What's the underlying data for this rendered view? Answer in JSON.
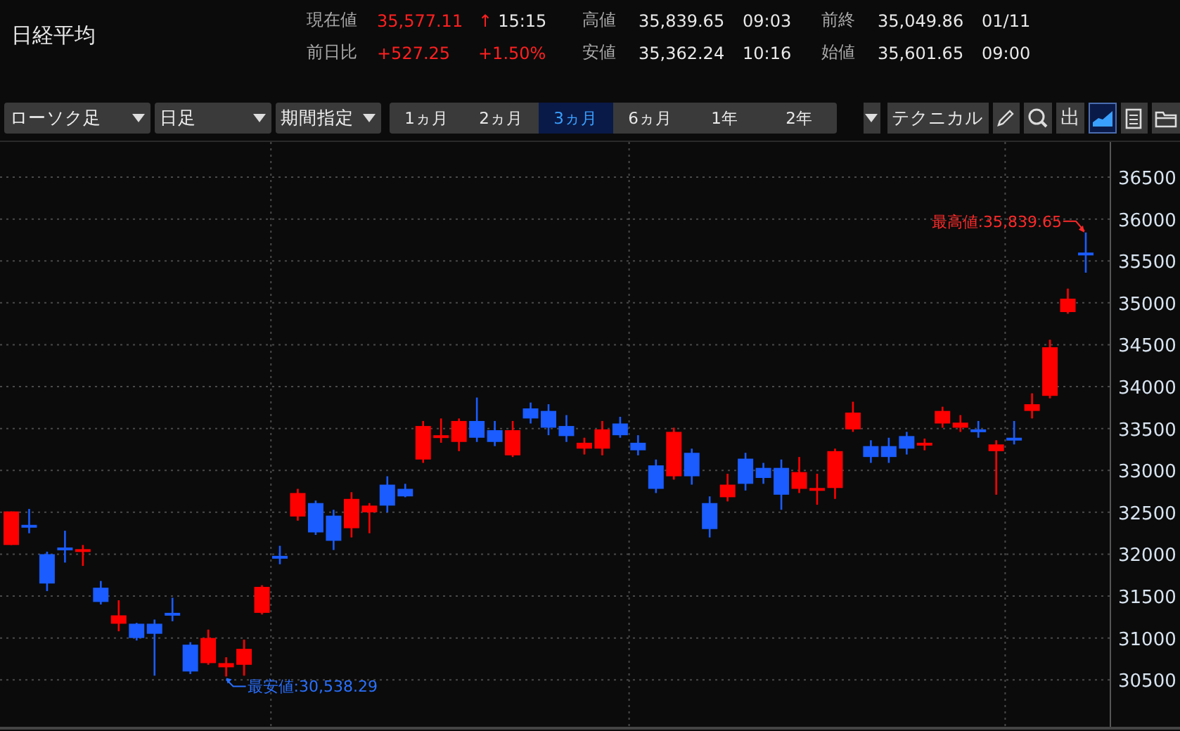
{
  "header": {
    "title": "日経平均",
    "quote": {
      "label": "現在値",
      "price": "35,577.11",
      "arrow": "↑",
      "time": "15:15",
      "change_label": "前日比",
      "change": "+527.25",
      "change_pct": "+1.50%"
    },
    "stats": [
      {
        "label": "高値",
        "value": "35,839.65",
        "time": "09:03"
      },
      {
        "label": "安値",
        "value": "35,362.24",
        "time": "10:16"
      },
      {
        "label": "前終",
        "value": "35,049.86",
        "time": "01/11"
      },
      {
        "label": "始値",
        "value": "35,601.65",
        "time": "09:00"
      }
    ]
  },
  "toolbar": {
    "dropdowns": [
      {
        "value": "ローソク足"
      },
      {
        "value": "日足"
      },
      {
        "value": "期間指定"
      }
    ],
    "periods": [
      {
        "label": "1ヵ月",
        "selected": false
      },
      {
        "label": "2ヵ月",
        "selected": false
      },
      {
        "label": "3ヵ月",
        "selected": true
      },
      {
        "label": "6ヵ月",
        "selected": false
      },
      {
        "label": "1年",
        "selected": false
      },
      {
        "label": "2年",
        "selected": false
      }
    ],
    "technical": "テクニカル",
    "tools": [
      {
        "kind": "pencil",
        "selected": false
      },
      {
        "kind": "zoom",
        "selected": false
      },
      {
        "kind": "text",
        "label": "出",
        "selected": false
      },
      {
        "kind": "chart",
        "selected": true
      },
      {
        "kind": "save",
        "selected": false
      },
      {
        "kind": "folder",
        "selected": false
      }
    ]
  },
  "chart": {
    "chart_data": {
      "type": "candlestick",
      "grid": true,
      "ylim": [
        29940,
        36920
      ],
      "yticks": [
        30500,
        31000,
        31500,
        32000,
        32500,
        33000,
        33500,
        34000,
        34500,
        35000,
        35500,
        36000,
        36500
      ],
      "ohlc": [
        [
          32110,
          32510,
          32110,
          32510
        ],
        [
          32350,
          32540,
          32250,
          32330
        ],
        [
          32000,
          32030,
          31560,
          31650
        ],
        [
          32080,
          32280,
          31900,
          32050
        ],
        [
          32030,
          32110,
          31860,
          32060
        ],
        [
          31600,
          31680,
          31400,
          31430
        ],
        [
          31170,
          31450,
          31080,
          31270
        ],
        [
          31170,
          31180,
          30970,
          31000
        ],
        [
          31170,
          31220,
          30550,
          31050
        ],
        [
          31300,
          31480,
          31200,
          31270
        ],
        [
          30920,
          30950,
          30570,
          30600
        ],
        [
          30700,
          31100,
          30680,
          31000
        ],
        [
          30650,
          30770,
          30540,
          30700
        ],
        [
          30680,
          30980,
          30550,
          30870
        ],
        [
          31300,
          31630,
          31280,
          31610
        ],
        [
          31980,
          32100,
          31880,
          31960
        ],
        [
          32450,
          32780,
          32400,
          32730
        ],
        [
          32610,
          32640,
          32230,
          32260
        ],
        [
          32460,
          32530,
          32050,
          32160
        ],
        [
          32310,
          32740,
          32200,
          32660
        ],
        [
          32500,
          32610,
          32250,
          32580
        ],
        [
          32830,
          32930,
          32500,
          32580
        ],
        [
          32780,
          32840,
          32680,
          32690
        ],
        [
          33130,
          33590,
          33090,
          33530
        ],
        [
          33390,
          33620,
          33330,
          33420
        ],
        [
          33340,
          33620,
          33230,
          33590
        ],
        [
          33590,
          33870,
          33340,
          33390
        ],
        [
          33480,
          33590,
          33290,
          33340
        ],
        [
          33180,
          33590,
          33160,
          33480
        ],
        [
          33740,
          33810,
          33560,
          33620
        ],
        [
          33710,
          33790,
          33420,
          33510
        ],
        [
          33530,
          33660,
          33340,
          33410
        ],
        [
          33260,
          33390,
          33190,
          33330
        ],
        [
          33260,
          33590,
          33180,
          33490
        ],
        [
          33560,
          33640,
          33390,
          33420
        ],
        [
          33330,
          33420,
          33180,
          33240
        ],
        [
          33060,
          33130,
          32730,
          32780
        ],
        [
          32930,
          33510,
          32890,
          33460
        ],
        [
          33210,
          33260,
          32830,
          32930
        ],
        [
          32610,
          32690,
          32200,
          32300
        ],
        [
          32680,
          32960,
          32630,
          32830
        ],
        [
          33140,
          33210,
          32760,
          32840
        ],
        [
          33030,
          33090,
          32840,
          32910
        ],
        [
          33030,
          33130,
          32530,
          32710
        ],
        [
          32780,
          33160,
          32730,
          32980
        ],
        [
          32780,
          32960,
          32590,
          32790
        ],
        [
          32790,
          33260,
          32660,
          33230
        ],
        [
          33490,
          33820,
          33460,
          33690
        ],
        [
          33290,
          33360,
          33090,
          33160
        ],
        [
          33290,
          33390,
          33090,
          33160
        ],
        [
          33410,
          33460,
          33190,
          33260
        ],
        [
          33310,
          33380,
          33240,
          33330
        ],
        [
          33560,
          33760,
          33510,
          33710
        ],
        [
          33510,
          33660,
          33460,
          33570
        ],
        [
          33490,
          33590,
          33390,
          33480
        ],
        [
          33230,
          33360,
          32710,
          33310
        ],
        [
          33390,
          33590,
          33310,
          33370
        ],
        [
          33710,
          33920,
          33620,
          33790
        ],
        [
          33890,
          34560,
          33860,
          34470
        ],
        [
          34890,
          35170,
          34870,
          35050
        ],
        [
          35600,
          35840,
          35360,
          35580
        ]
      ],
      "annotations": [
        "最高値:35,839.65",
        "最安値:30,538.29"
      ]
    }
  }
}
